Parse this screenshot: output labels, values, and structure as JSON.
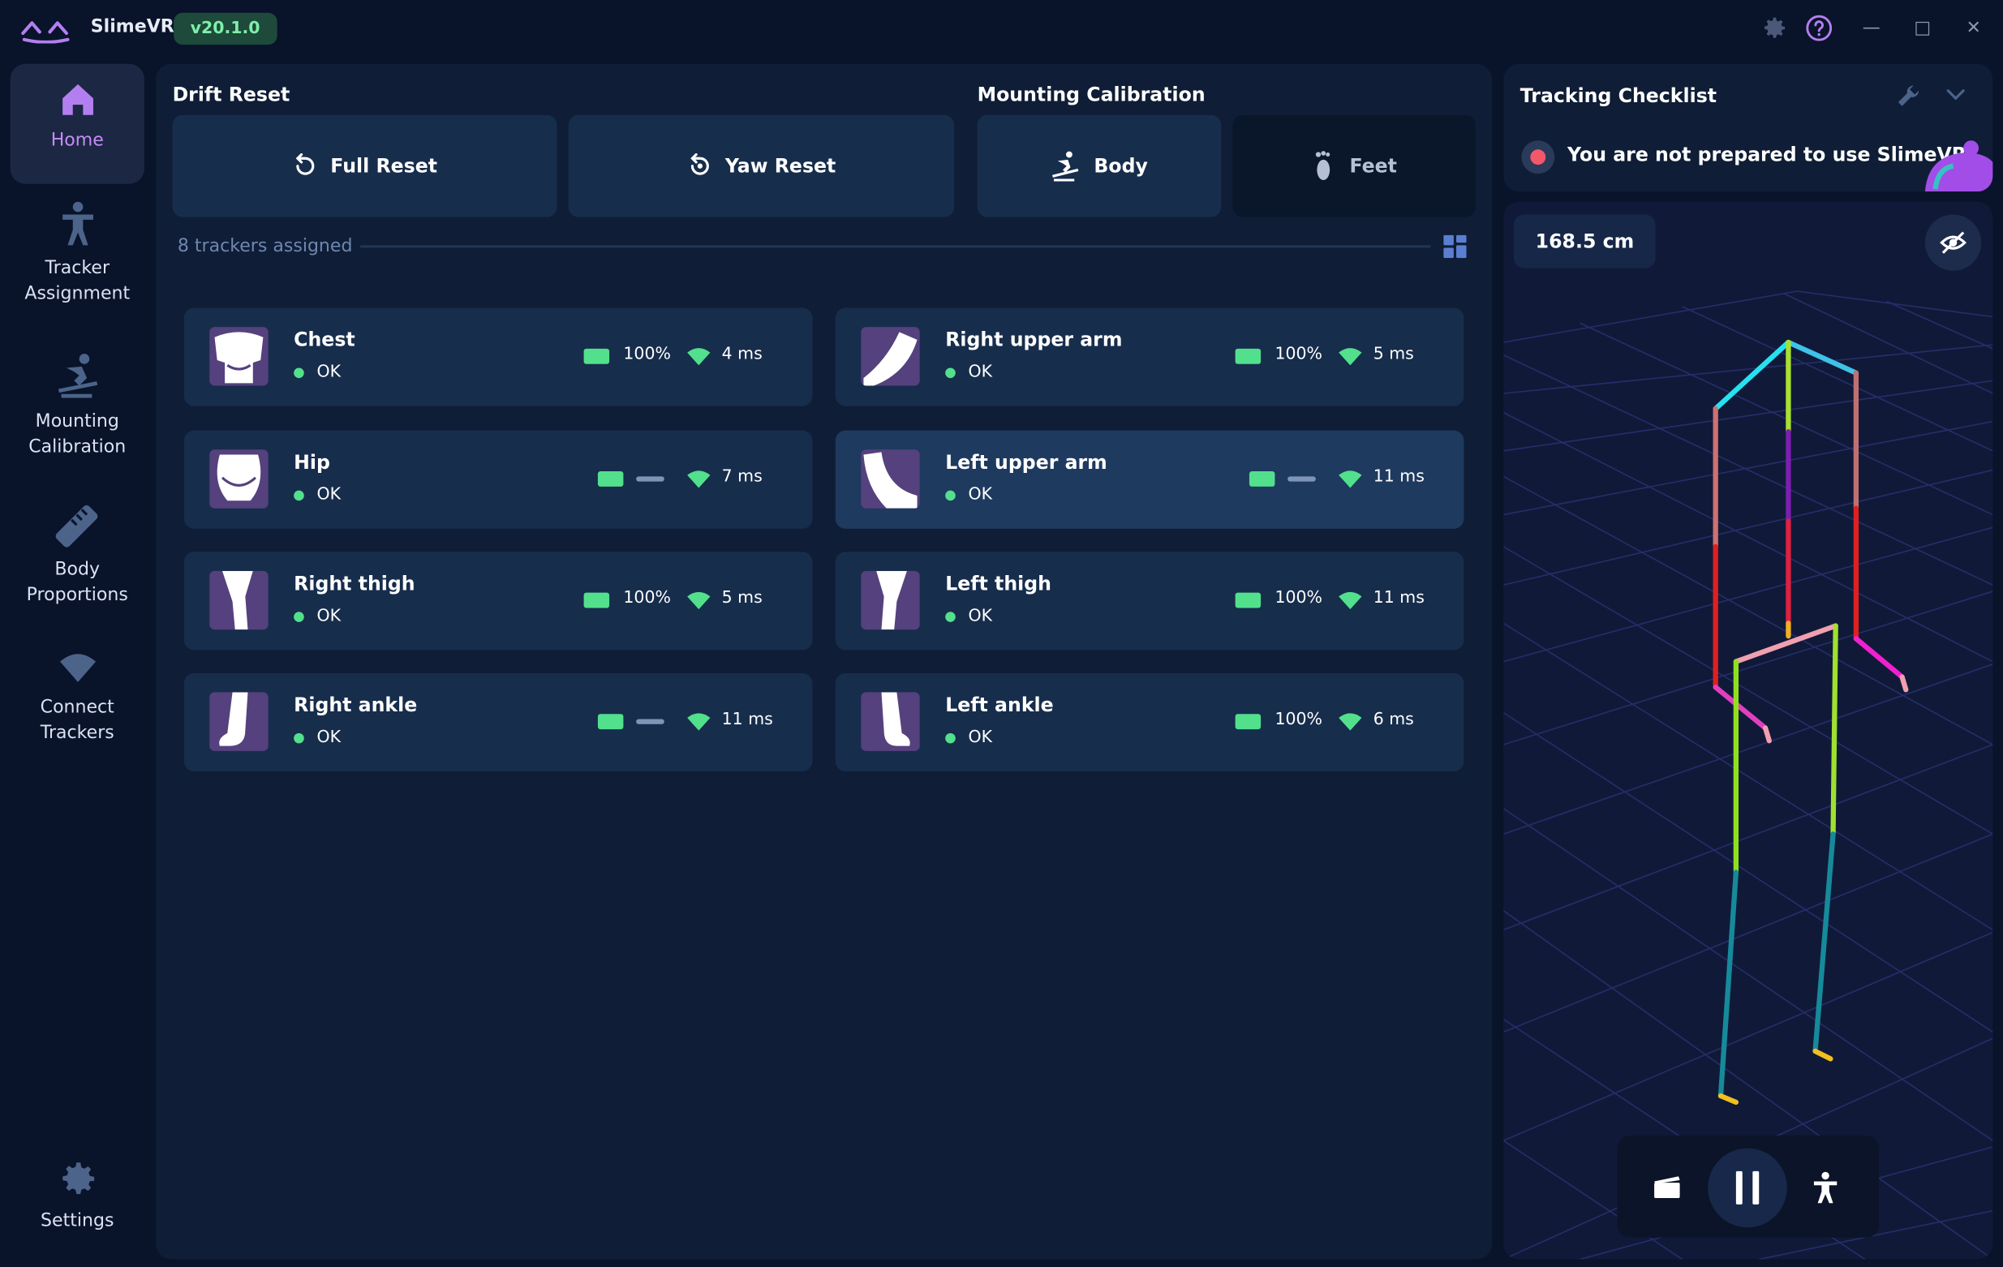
{
  "app": {
    "title": "SlimeVR",
    "version": "v20.1.0"
  },
  "sidebar": {
    "items": [
      {
        "label": "Home",
        "icon": "home-icon",
        "active": true
      },
      {
        "label": "Tracker Assignment",
        "icon": "person-icon"
      },
      {
        "label": "Mounting Calibration",
        "icon": "skier-icon"
      },
      {
        "label": "Body Proportions",
        "icon": "ruler-icon"
      },
      {
        "label": "Connect Trackers",
        "icon": "wifi-icon"
      }
    ],
    "settings_label": "Settings"
  },
  "drift_reset": {
    "title": "Drift Reset",
    "full_reset": "Full Reset",
    "yaw_reset": "Yaw Reset"
  },
  "mounting": {
    "title": "Mounting Calibration",
    "body": "Body",
    "feet": "Feet"
  },
  "trackers_assigned": "8 trackers assigned",
  "trackers": [
    {
      "name": "Chest",
      "status": "OK",
      "battery": "100%",
      "charging": false,
      "ping": "4 ms"
    },
    {
      "name": "Right upper arm",
      "status": "OK",
      "battery": "100%",
      "charging": false,
      "ping": "5 ms"
    },
    {
      "name": "Hip",
      "status": "OK",
      "battery": "",
      "charging": true,
      "ping": "7 ms"
    },
    {
      "name": "Left upper arm",
      "status": "OK",
      "battery": "",
      "charging": true,
      "ping": "11 ms",
      "highlighted": true
    },
    {
      "name": "Right thigh",
      "status": "OK",
      "battery": "100%",
      "charging": false,
      "ping": "5 ms"
    },
    {
      "name": "Left thigh",
      "status": "OK",
      "battery": "100%",
      "charging": false,
      "ping": "11 ms"
    },
    {
      "name": "Right ankle",
      "status": "OK",
      "battery": "",
      "charging": true,
      "ping": "11 ms"
    },
    {
      "name": "Left ankle",
      "status": "OK",
      "battery": "100%",
      "charging": false,
      "ping": "6 ms"
    }
  ],
  "checklist": {
    "title": "Tracking Checklist",
    "warning": "You are not prepared to use SlimeVR!"
  },
  "viewer": {
    "height": "168.5 cm"
  },
  "colors": {
    "accent": "#c58cf5",
    "ok": "#52e08c",
    "card": "#172d4c",
    "panel": "#0f1d36",
    "background": "#09132a"
  }
}
